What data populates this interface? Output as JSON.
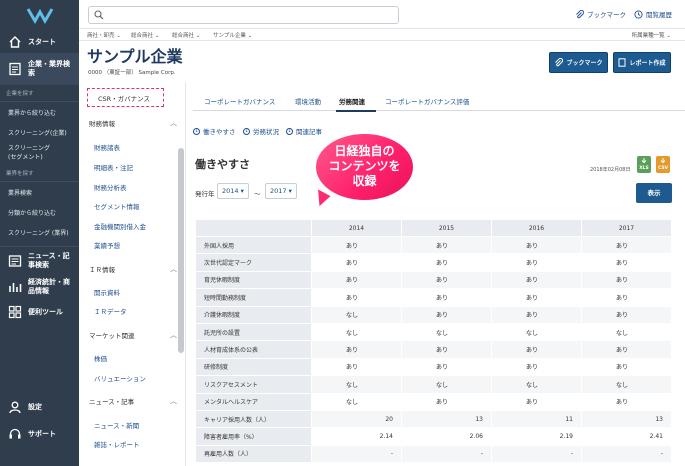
{
  "leftnav": {
    "items": [
      {
        "label": "スタート",
        "icon": "home-icon"
      },
      {
        "label": "企業・業界検索",
        "icon": "document-icon"
      }
    ],
    "section_company": "企業を探す",
    "company_links": [
      "業界から絞り込む",
      "スクリーニング(企業)",
      "スクリーニング(セグメント)"
    ],
    "section_industry": "業界を探す",
    "industry_links": [
      "業界検索",
      "分類から絞り込む",
      "スクリーニング (業界)"
    ],
    "items2": [
      {
        "label": "ニュース・記事検索",
        "icon": "news-icon"
      },
      {
        "label": "経済統計・商品情報",
        "icon": "chart-icon"
      },
      {
        "label": "便利ツール",
        "icon": "grid-icon"
      }
    ],
    "settings_label": "設定",
    "support_label": "サポート"
  },
  "topbar": {
    "search_placeholder": "",
    "bookmark_label": "ブックマーク",
    "history_label": "閲覧履歴"
  },
  "crumbs": [
    "商社・卸売",
    "総合商社",
    "総合商社",
    "サンプル企業"
  ],
  "crumb_right": "所属業種一覧",
  "company": {
    "name": "サンプル企業",
    "code_line": "0000 （東証一部） Sample Corp.",
    "bookmark_btn": "ブックマーク",
    "report_btn": "レポート作成"
  },
  "sidebar": {
    "csr_label": "CSR・ガバナンス",
    "financial_head": "財務情報",
    "financial_items": [
      "財務諸表",
      "明細表・注記",
      "財務分析表",
      "セグメント情報",
      "金融機関別借入金",
      "業績予想"
    ],
    "ir_head": "ＩＲ情報",
    "ir_items": [
      "開示資料",
      "ＩＲデータ"
    ],
    "market_head": "マーケット関連",
    "market_items": [
      "株価",
      "バリュエーション"
    ],
    "news_head": "ニュース・記事",
    "news_items": [
      "ニュース・新聞",
      "雑誌・レポート"
    ]
  },
  "tabs": [
    "コーポレートガバナンス",
    "環境活動",
    "労務関連",
    "コーポレートガバナンス評価"
  ],
  "active_tab": "労務関連",
  "anchors": [
    "働きやすさ",
    "労務状況",
    "関連記事"
  ],
  "section": {
    "title": "働きやすさ",
    "date": "2018年02月08日",
    "xls": "XLS",
    "csv": "CSV"
  },
  "filter": {
    "label": "発行年",
    "from": "2014 ▾",
    "tilde": "〜",
    "to": "2017 ▾",
    "show_btn": "表示"
  },
  "table": {
    "years": [
      "2014",
      "2015",
      "2016",
      "2017"
    ],
    "rows": [
      {
        "label": "外国人採用",
        "values": [
          "あり",
          "あり",
          "あり",
          "あり"
        ],
        "num": false
      },
      {
        "label": "次世代認定マーク",
        "values": [
          "あり",
          "あり",
          "あり",
          "あり"
        ],
        "num": false
      },
      {
        "label": "育児休暇制度",
        "values": [
          "あり",
          "あり",
          "あり",
          "あり"
        ],
        "num": false
      },
      {
        "label": "短時間勤務制度",
        "values": [
          "あり",
          "あり",
          "あり",
          "あり"
        ],
        "num": false
      },
      {
        "label": "介護休暇制度",
        "values": [
          "なし",
          "あり",
          "あり",
          "あり"
        ],
        "num": false
      },
      {
        "label": "託児所の設置",
        "values": [
          "なし",
          "なし",
          "なし",
          "なし"
        ],
        "num": false
      },
      {
        "label": "人材育成体系の公表",
        "values": [
          "あり",
          "あり",
          "あり",
          "あり"
        ],
        "num": false
      },
      {
        "label": "研修制度",
        "values": [
          "あり",
          "あり",
          "あり",
          "あり"
        ],
        "num": false
      },
      {
        "label": "リスクアセスメント",
        "values": [
          "なし",
          "なし",
          "なし",
          "なし"
        ],
        "num": false
      },
      {
        "label": "メンタルヘルスケア",
        "values": [
          "なし",
          "あり",
          "あり",
          "あり"
        ],
        "num": false
      },
      {
        "label": "キャリア採用人数（人）",
        "values": [
          "20",
          "13",
          "11",
          "13"
        ],
        "num": true
      },
      {
        "label": "障害者雇用率（%）",
        "values": [
          "2.14",
          "2.06",
          "2.19",
          "2.41"
        ],
        "num": true
      },
      {
        "label": "再雇用人数（人）",
        "values": [
          "-",
          "-",
          "-",
          "-"
        ],
        "num": true
      }
    ]
  },
  "promo": {
    "line1": "日経独自の",
    "line2": "コンテンツを",
    "line3": "収録"
  },
  "colors": {
    "nav_bg": "#2f3d4c",
    "brand_blue": "#1d5a8f",
    "promo_pink": "#ff1f6b",
    "xls_green": "#5aa05a",
    "csv_orange": "#e39b2b"
  }
}
